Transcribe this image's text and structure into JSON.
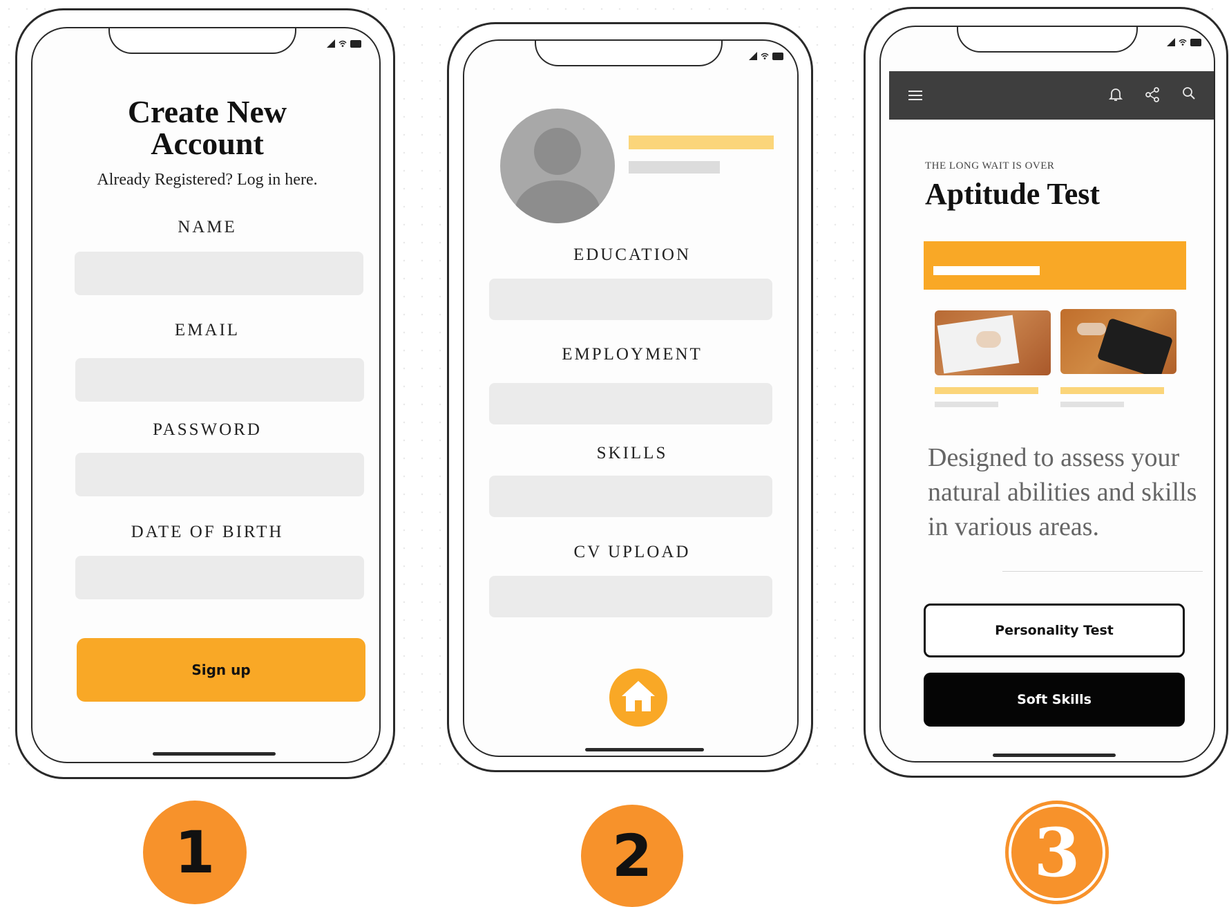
{
  "screen1": {
    "title_line1": "Create New",
    "title_line2": "Account",
    "login_prompt": "Already Registered? Log in here.",
    "fields": [
      "NAME",
      "EMAIL",
      "PASSWORD",
      "DATE OF BIRTH"
    ],
    "signup_label": "Sign up",
    "badge": "1"
  },
  "screen2": {
    "fields": [
      "EDUCATION",
      "EMPLOYMENT",
      "SKILLS",
      "CV UPLOAD"
    ],
    "badge": "2"
  },
  "screen3": {
    "eyebrow": "THE LONG WAIT IS OVER",
    "title": "Aptitude Test",
    "description": "Designed to assess your natural abilities and skills in various areas.",
    "button_personality": "Personality Test",
    "button_soft_skills": "Soft Skills",
    "badge": "3"
  },
  "icons": [
    "menu-icon",
    "bell-icon",
    "share-icon",
    "search-icon",
    "home-icon",
    "avatar-icon"
  ],
  "colors": {
    "accent": "#f9a826",
    "badge": "#f7922b",
    "appbar": "#3e3e3e",
    "placeholder_yellow": "#fbd57a",
    "placeholder_gray": "#dcdcdc"
  }
}
